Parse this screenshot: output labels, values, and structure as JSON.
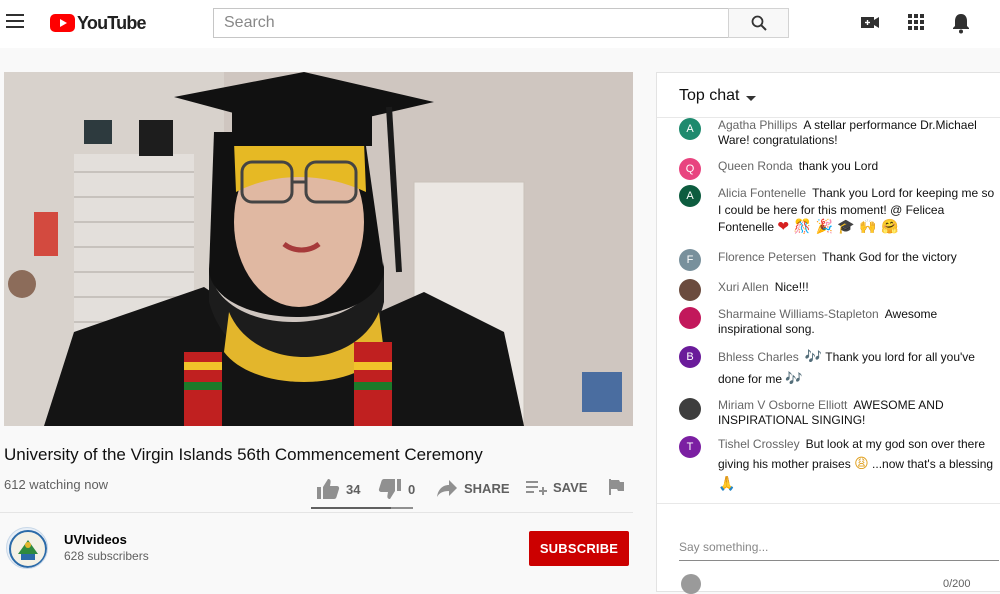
{
  "header": {
    "logo_text": "YouTube",
    "search_placeholder": "Search",
    "icons": [
      "menu-icon",
      "search-icon",
      "create-video-icon",
      "apps-grid-icon",
      "notifications-bell-icon"
    ]
  },
  "video": {
    "title": "University of the Virgin Islands 56th Commencement Ceremony",
    "watching": "612 watching now",
    "likes": "34",
    "dislikes": "0",
    "share_label": "SHARE",
    "save_label": "SAVE",
    "like_ratio": 0.78
  },
  "channel": {
    "name": "UVIvideos",
    "subscribers": "628 subscribers",
    "subscribe_label": "SUBSCRIBE"
  },
  "chat": {
    "header": "Top chat",
    "messages": [
      {
        "author": "Agatha Phillips",
        "text": "A stellar performance Dr.Michael Ware! congratulations!",
        "initial": "A",
        "color": "#1e8a6e"
      },
      {
        "author": "Queen Ronda",
        "text": "thank you Lord",
        "initial": "Q",
        "color": "#e8447f"
      },
      {
        "author": "Alicia Fontenelle",
        "text": "Thank you Lord for keeping me so I could be here for this moment! @ Felicea Fontenelle",
        "initial": "A",
        "color": "#0d5c3f",
        "emojis": "❤ 🎊 🎉 🎓 🙌 🤗"
      },
      {
        "author": "Florence Petersen",
        "text": "Thank God for the victory",
        "initial": "F",
        "color": "#78909c"
      },
      {
        "author": "Xuri Allen",
        "text": "Nice!!!",
        "initial": "",
        "color": "#6b4b3e"
      },
      {
        "author": "Sharmaine Williams-Stapleton",
        "text": "Awesome inspirational song.",
        "initial": "",
        "color": "#c2185b"
      },
      {
        "author": "Bhless Charles",
        "text": "Thank you lord for all you've done for me",
        "initial": "B",
        "color": "#6a1b9a",
        "emoji_a": "🎶",
        "emoji_b": "🎶"
      },
      {
        "author": "Miriam V Osborne Elliott",
        "text": "AWESOME AND INSPIRATIONAL SINGING!",
        "initial": "",
        "color": "#3e3e3e"
      },
      {
        "author": "Tishel Crossley",
        "text_a": "But look at my god son over there giving his mother praises",
        "text_b": "...now that's a blessing",
        "initial": "T",
        "color": "#7b1fa2",
        "emoji_a": "😩",
        "emoji_b": "🙏"
      }
    ],
    "input_placeholder": "Say something...",
    "counter": "0/200"
  }
}
